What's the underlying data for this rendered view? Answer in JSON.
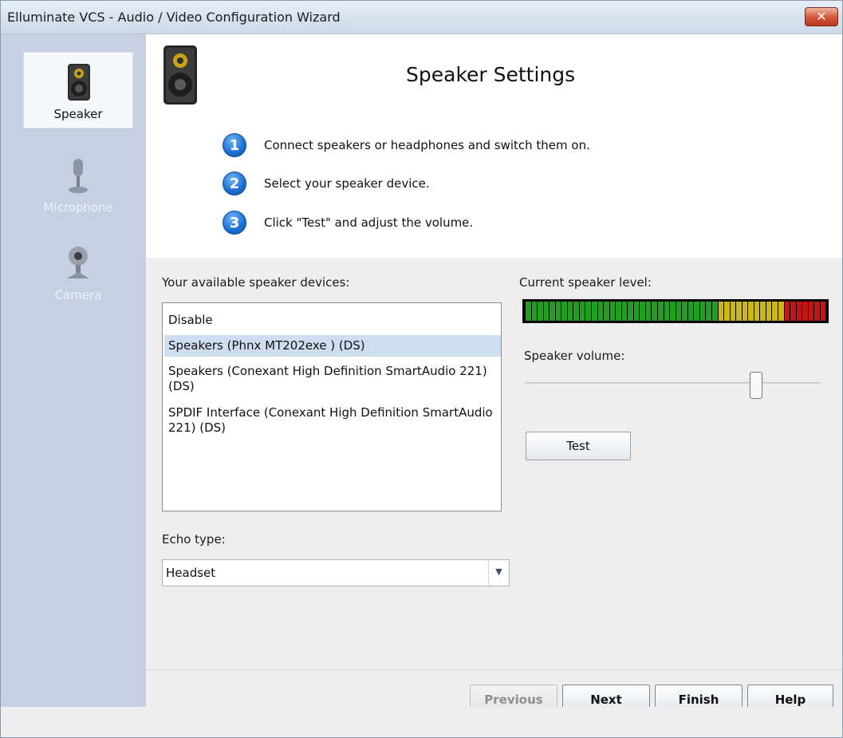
{
  "window": {
    "title": "Elluminate VCS - Audio / Video Configuration Wizard",
    "close_label": "✕"
  },
  "sidebar": {
    "items": [
      {
        "label": "Speaker",
        "icon": "speaker-icon",
        "active": true
      },
      {
        "label": "Microphone",
        "icon": "microphone-icon",
        "active": false
      },
      {
        "label": "Camera",
        "icon": "webcam-icon",
        "active": false
      }
    ]
  },
  "header": {
    "title": "Speaker Settings",
    "steps": [
      {
        "num": "1",
        "text": "Connect speakers or headphones and switch them on."
      },
      {
        "num": "2",
        "text": "Select your speaker device."
      },
      {
        "num": "3",
        "text": "Click \"Test\" and adjust the volume."
      }
    ]
  },
  "devices": {
    "label": "Your available speaker devices:",
    "items": [
      {
        "text": "Disable",
        "selected": false
      },
      {
        "text": "Speakers (Phnx MT202exe ) (DS)",
        "selected": true
      },
      {
        "text": "Speakers (Conexant High Definition SmartAudio 221) (DS)",
        "selected": false
      },
      {
        "text": "SPDIF Interface (Conexant High Definition SmartAudio 221) (DS)",
        "selected": false
      }
    ]
  },
  "level": {
    "label": "Current speaker level:",
    "segments_total": 50,
    "segments_green": 32,
    "segments_yellow": 11,
    "segments_red": 7,
    "colors": {
      "green": "#1f9e1f",
      "yellow": "#c9b61a",
      "red": "#c41414"
    }
  },
  "volume": {
    "label": "Speaker volume:",
    "value_fraction": 0.78
  },
  "test_button": "Test",
  "echo": {
    "label": "Echo type:",
    "value": "Headset"
  },
  "footer": {
    "previous": "Previous",
    "next": "Next",
    "finish": "Finish",
    "help": "Help"
  }
}
